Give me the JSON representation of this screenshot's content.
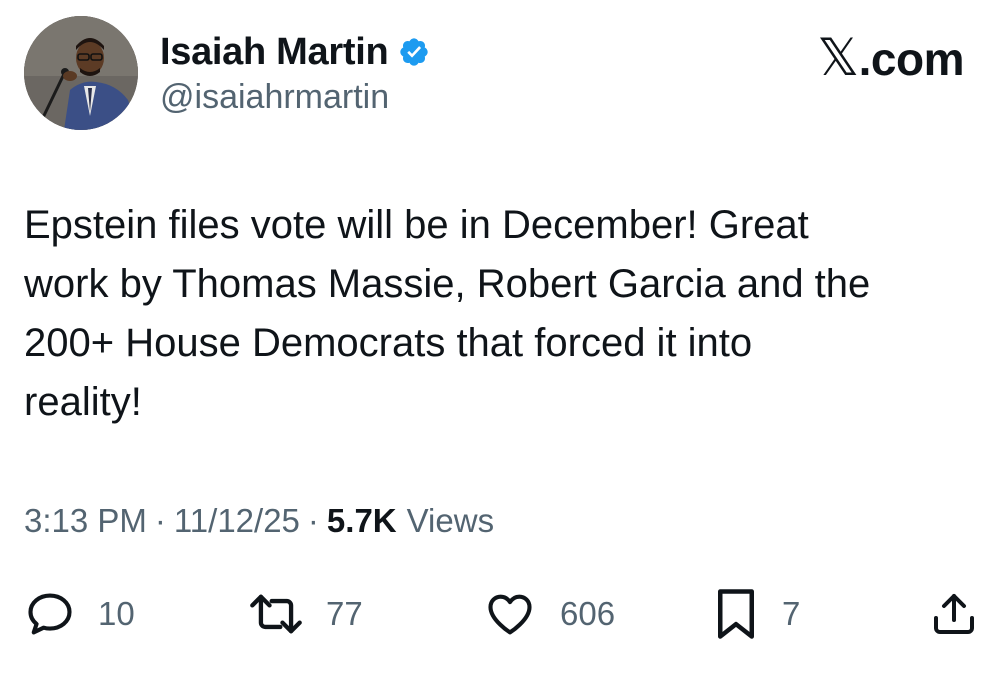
{
  "author": {
    "name": "Isaiah Martin",
    "handle": "@isaiahrmartin",
    "verified": true,
    "verified_color": "#1d9bf0"
  },
  "brand": {
    "glyph": "𝕏",
    "suffix": ".com"
  },
  "tweet": {
    "text": "Epstein files vote will be in December! Great\nwork by Thomas Massie, Robert Garcia and the\n200+ House Democrats that forced it into\nreality!"
  },
  "meta": {
    "time": "3:13 PM",
    "date": "11/12/25",
    "separator": "·",
    "views_count": "5.7K",
    "views_label": "Views"
  },
  "actions": {
    "replies": "10",
    "reposts": "77",
    "likes": "606",
    "bookmarks": "7"
  },
  "icons": {
    "reply": "reply-icon",
    "repost": "repost-icon",
    "like": "heart-icon",
    "bookmark": "bookmark-icon",
    "share": "share-icon"
  },
  "colors": {
    "text": "#0f1419",
    "muted": "#536471",
    "accent": "#1d9bf0"
  }
}
